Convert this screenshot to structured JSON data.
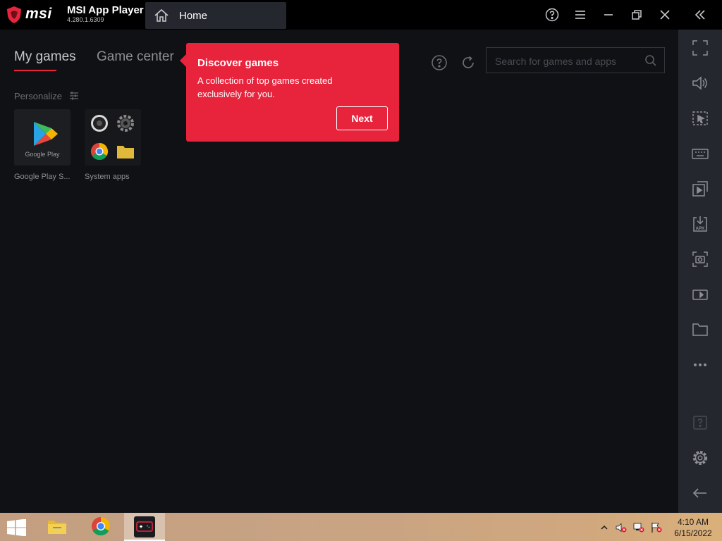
{
  "titlebar": {
    "brand": "msi",
    "app_name": "MSI App Player",
    "version": "4.280.1.6309",
    "home_tab": "Home",
    "icons": [
      "home-icon",
      "help-icon",
      "menu-icon",
      "minimize-icon",
      "restore-icon",
      "close-icon",
      "collapse-double-chevron-icon"
    ]
  },
  "tabs": [
    {
      "label": "My games",
      "active": true
    },
    {
      "label": "Game center",
      "active": false
    }
  ],
  "search": {
    "placeholder": "Search for games and apps",
    "value": ""
  },
  "personalize": {
    "label": "Personalize"
  },
  "apps": [
    {
      "label": "Google Play S...",
      "tile_text": "Google Play"
    },
    {
      "label": "System apps"
    }
  ],
  "tooltip": {
    "title": "Discover games",
    "description": "A collection of top games created exclusively for you.",
    "button": "Next"
  },
  "right_toolbar": {
    "icons": [
      "fullscreen-icon",
      "volume-icon",
      "screen-select-icon",
      "keyboard-icon",
      "media-manager-icon",
      "apk-install-icon",
      "screenshot-icon",
      "record-icon",
      "folder-icon",
      "more-icon",
      "help-icon",
      "settings-icon",
      "back-icon"
    ]
  },
  "taskbar": {
    "time": "4:10 AM",
    "date": "6/15/2022",
    "apps": [
      "start-icon",
      "file-explorer-icon",
      "chrome-icon",
      "msi-app-player-icon"
    ]
  },
  "colors": {
    "accent": "#e8243d",
    "background": "#101115",
    "toolbar": "#25272f",
    "titlebar": "#000000"
  }
}
